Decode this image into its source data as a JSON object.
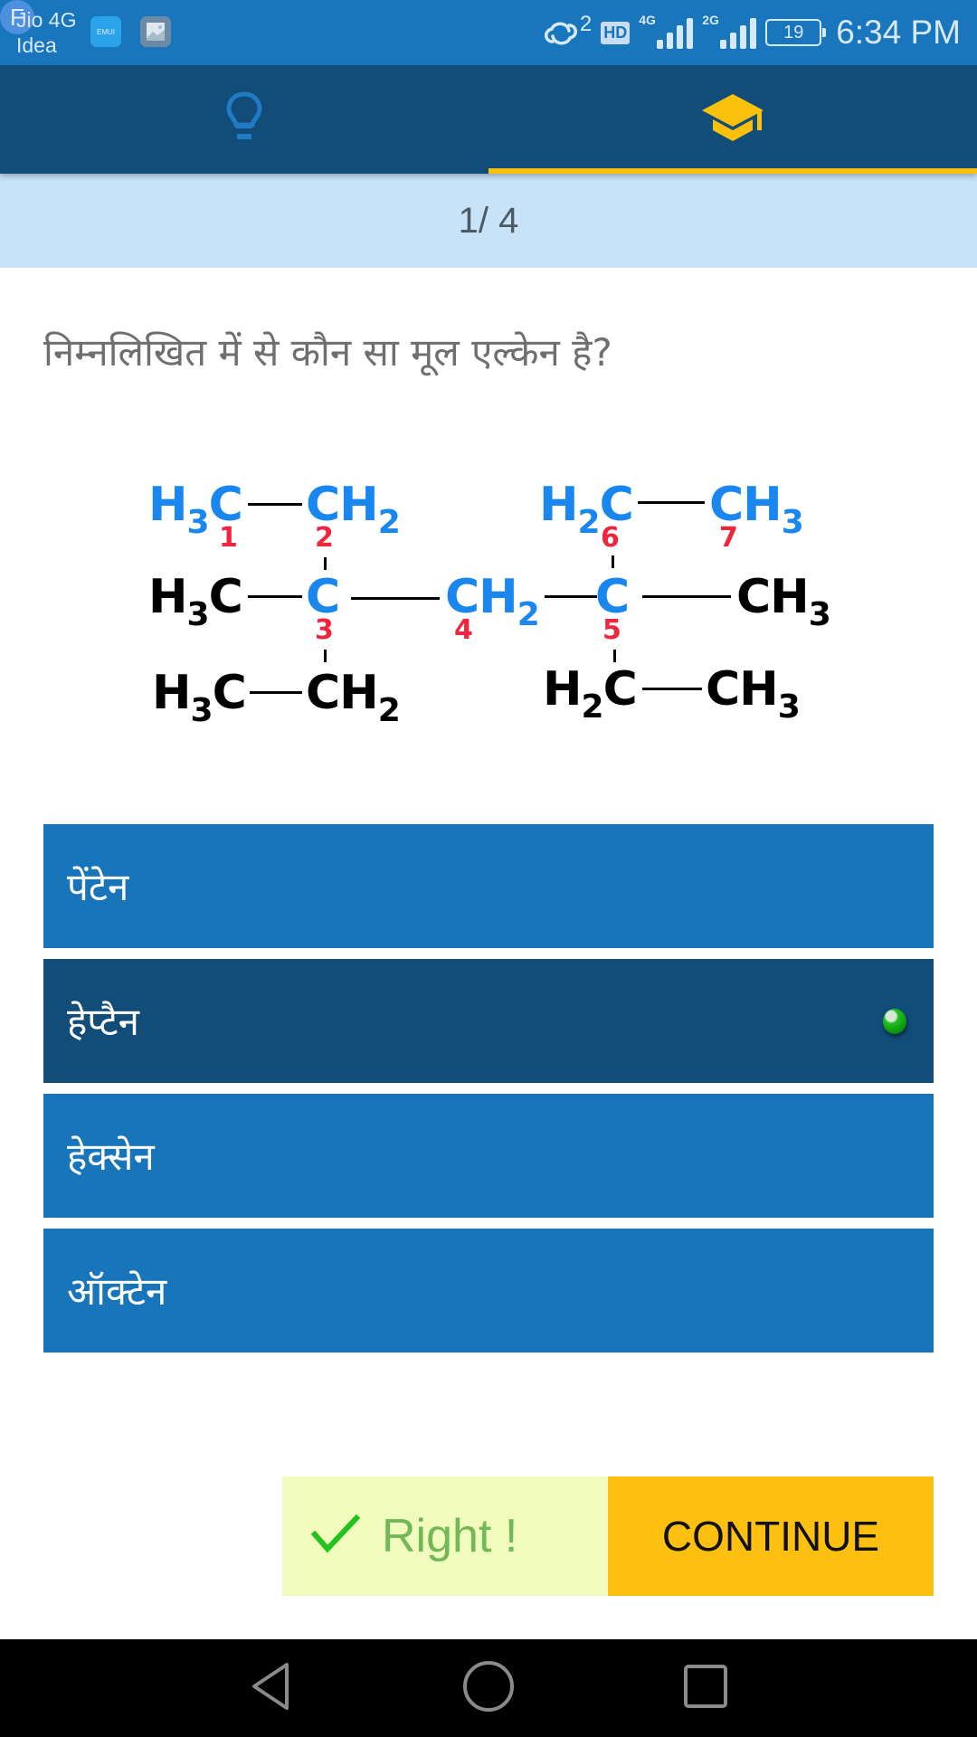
{
  "status_bar": {
    "carrier_line1": "Jio 4G",
    "carrier_line2": "Idea",
    "notifications": [
      {
        "name": "emui-icon",
        "label": "EMUI"
      },
      {
        "name": "gallery-icon",
        "label": ""
      },
      {
        "name": "f-app-icon",
        "label": "F"
      }
    ],
    "sync_count": "2",
    "hd_label": "HD",
    "sim1_network": "4G",
    "sim2_network": "2G",
    "battery_level": "19",
    "time": "6:34 PM"
  },
  "tabs": [
    {
      "name": "tab-hint",
      "icon": "lightbulb-icon",
      "active": false
    },
    {
      "name": "tab-learn",
      "icon": "graduation-cap-icon",
      "active": true
    }
  ],
  "progress": {
    "text": "1/ 4",
    "current": 1,
    "total": 4
  },
  "question": {
    "text": "निम्नलिखित में से कौन सा मूल एल्केन है?"
  },
  "structure": {
    "top_left": {
      "h": "H",
      "sub": "3",
      "c": "C"
    },
    "top_left_2": {
      "c": "CH",
      "sub": "2"
    },
    "top_right_1": {
      "h": "H",
      "sub": "2",
      "c": "C"
    },
    "top_right_2": {
      "c": "CH",
      "sub": "3"
    },
    "mid_left": {
      "h": "H",
      "sub": "3",
      "c": "C"
    },
    "mid_c3": "C",
    "mid_ch2": {
      "c": "CH",
      "sub": "2"
    },
    "mid_c5": "C",
    "mid_right": {
      "c": "CH",
      "sub": "3"
    },
    "bot_left": {
      "h": "H",
      "sub": "3",
      "c": "C"
    },
    "bot_left_2": {
      "c": "CH",
      "sub": "2"
    },
    "bot_right_1": {
      "h": "H",
      "sub": "2",
      "c": "C"
    },
    "bot_right_2": {
      "c": "CH",
      "sub": "3"
    },
    "numbers": [
      "1",
      "2",
      "3",
      "4",
      "5",
      "6",
      "7"
    ],
    "colors": {
      "main_chain": "#1a86f0",
      "numbering": "#f0263e",
      "branch": "#000000"
    }
  },
  "options": [
    {
      "label": "पेंटेन",
      "selected": false
    },
    {
      "label": "हेप्टैन",
      "selected": true
    },
    {
      "label": "हेक्सेन",
      "selected": false
    },
    {
      "label": "ऑक्टेन",
      "selected": false
    }
  ],
  "result": {
    "text": "Right !",
    "icon": "check-icon",
    "color": "#72b857"
  },
  "continue_button": {
    "label": "CONTINUE",
    "color": "#fdc010"
  },
  "nav_bar": {
    "back": "back-icon",
    "home": "home-icon",
    "recents": "recents-icon"
  },
  "colors": {
    "status_bar": "#1976bc",
    "tab_bar": "#124c78",
    "tab_indicator": "#f9c00c",
    "progress_band": "#c8e2f7",
    "option": "#1875ba",
    "option_selected": "#114d78"
  }
}
